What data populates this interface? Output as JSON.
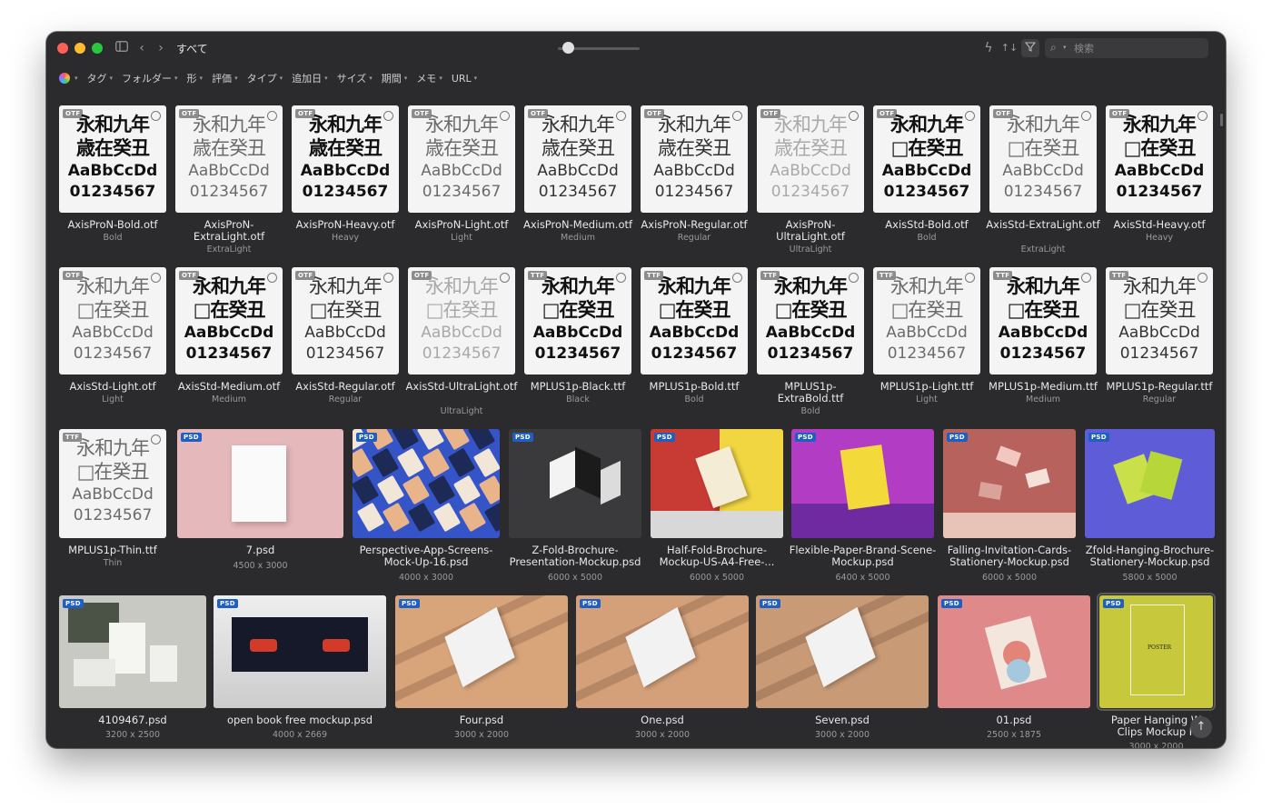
{
  "titlebar": {
    "title": "すべて",
    "search_placeholder": "検索",
    "icons": [
      "sidebar-toggle-icon",
      "back-icon",
      "forward-icon",
      "lightning-icon",
      "sort-icon",
      "filter-icon",
      "search-icon"
    ]
  },
  "filters": [
    "タグ",
    "フォルダー",
    "形",
    "評価",
    "タイプ",
    "追加日",
    "サイズ",
    "期間",
    "メモ",
    "URL"
  ],
  "sample": {
    "line1": "永和九年",
    "line2": "歳在癸丑",
    "line2_missing": "□在癸丑",
    "line3": "AaBbCcDd",
    "line4": "01234567"
  },
  "fonts_row1": [
    {
      "type": "OTF",
      "name": "AxisProN-Bold.otf",
      "style": "Bold",
      "weight": "bold",
      "full": true
    },
    {
      "type": "OTF",
      "name": "AxisProN-ExtraLight.otf",
      "style": "ExtraLight",
      "weight": "light",
      "full": true
    },
    {
      "type": "OTF",
      "name": "AxisProN-Heavy.otf",
      "style": "Heavy",
      "weight": "bold",
      "full": true
    },
    {
      "type": "OTF",
      "name": "AxisProN-Light.otf",
      "style": "Light",
      "weight": "light",
      "full": true
    },
    {
      "type": "OTF",
      "name": "AxisProN-Medium.otf",
      "style": "Medium",
      "weight": "reg",
      "full": true
    },
    {
      "type": "OTF",
      "name": "AxisProN-Regular.otf",
      "style": "Regular",
      "weight": "reg",
      "full": true
    },
    {
      "type": "OTF",
      "name": "AxisProN-UltraLight.otf",
      "style": "UltraLight",
      "weight": "ulight",
      "full": true
    },
    {
      "type": "OTF",
      "name": "AxisStd-Bold.otf",
      "style": "Bold",
      "weight": "bold",
      "full": false
    },
    {
      "type": "OTF",
      "name": "AxisStd-ExtraLight.otf",
      "style": "ExtraLight",
      "weight": "light",
      "full": false
    },
    {
      "type": "OTF",
      "name": "AxisStd-Heavy.otf",
      "style": "Heavy",
      "weight": "bold",
      "full": false
    }
  ],
  "fonts_row2": [
    {
      "type": "OTF",
      "name": "AxisStd-Light.otf",
      "style": "Light",
      "weight": "light",
      "full": false
    },
    {
      "type": "OTF",
      "name": "AxisStd-Medium.otf",
      "style": "Medium",
      "weight": "bold",
      "full": false
    },
    {
      "type": "OTF",
      "name": "AxisStd-Regular.otf",
      "style": "Regular",
      "weight": "reg",
      "full": false
    },
    {
      "type": "OTF",
      "name": "AxisStd-UltraLight.otf",
      "style": "UltraLight",
      "weight": "ulight",
      "full": false
    },
    {
      "type": "TTF",
      "name": "MPLUS1p-Black.ttf",
      "style": "Black",
      "weight": "bold",
      "full": false
    },
    {
      "type": "TTF",
      "name": "MPLUS1p-Bold.ttf",
      "style": "Bold",
      "weight": "bold",
      "full": false
    },
    {
      "type": "TTF",
      "name": "MPLUS1p-ExtraBold.ttf",
      "style": "Bold",
      "weight": "bold",
      "full": false
    },
    {
      "type": "TTF",
      "name": "MPLUS1p-Light.ttf",
      "style": "Light",
      "weight": "light",
      "full": false
    },
    {
      "type": "TTF",
      "name": "MPLUS1p-Medium.ttf",
      "style": "Medium",
      "weight": "bold",
      "full": false
    },
    {
      "type": "TTF",
      "name": "MPLUS1p-Regular.ttf",
      "style": "Regular",
      "weight": "reg",
      "full": false
    }
  ],
  "row3": [
    {
      "kind": "font",
      "type": "TTF",
      "name": "MPLUS1p-Thin.ttf",
      "sub": "Thin",
      "weight": "light"
    },
    {
      "kind": "psd",
      "name": "7.psd",
      "sub": "4500 x 3000",
      "bg": "#e5b8bb"
    },
    {
      "kind": "psd",
      "name": "Perspective-App-Screens-Mock-Up-16.psd",
      "sub": "4000 x 3000",
      "bg": "#3554c8"
    },
    {
      "kind": "psd",
      "name": "Z-Fold-Brochure-Presentation-Mockup.psd",
      "sub": "6000 x 5000",
      "bg": "#3a3a3c"
    },
    {
      "kind": "psd",
      "name": "Half-Fold-Brochure-Mockup-US-A4-Free-...",
      "sub": "6000 x 5000",
      "bg": "#c83a34"
    },
    {
      "kind": "psd",
      "name": "Flexible-Paper-Brand-Scene-Mockup.psd",
      "sub": "6400 x 5000",
      "bg": "#b23cc4"
    },
    {
      "kind": "psd",
      "name": "Falling-Invitation-Cards-Stationery-Mockup.psd",
      "sub": "6000 x 5000",
      "bg": "#b8625d"
    },
    {
      "kind": "psd",
      "name": "Zfold-Hanging-Brochure-Stationery-Mockup.psd",
      "sub": "5800 x 5000",
      "bg": "#5f5cd8"
    }
  ],
  "row4": [
    {
      "name": "4109467.psd",
      "sub": "3200 x 2500",
      "bg": "#c9c9c4"
    },
    {
      "name": "open book free mockup.psd",
      "sub": "4000 x 2669",
      "bg": "#d6d6d6"
    },
    {
      "name": "Four.psd",
      "sub": "3000 x 2000",
      "bg": "#d8a47a"
    },
    {
      "name": "One.psd",
      "sub": "3000 x 2000",
      "bg": "#d4a07a"
    },
    {
      "name": "Seven.psd",
      "sub": "3000 x 2000",
      "bg": "#c89a76"
    },
    {
      "name": "01.psd",
      "sub": "2500 x 1875",
      "bg": "#e0898a"
    },
    {
      "name": "Paper Hanging W Clips Mockup F",
      "sub": "3000 x 2000",
      "bg": "#c8c83c"
    }
  ],
  "poster_text": "POSTER",
  "colors": {
    "window": "#2b2b2d",
    "psd_badge": "#1f5fc4",
    "selection": "#5a5a5e"
  }
}
